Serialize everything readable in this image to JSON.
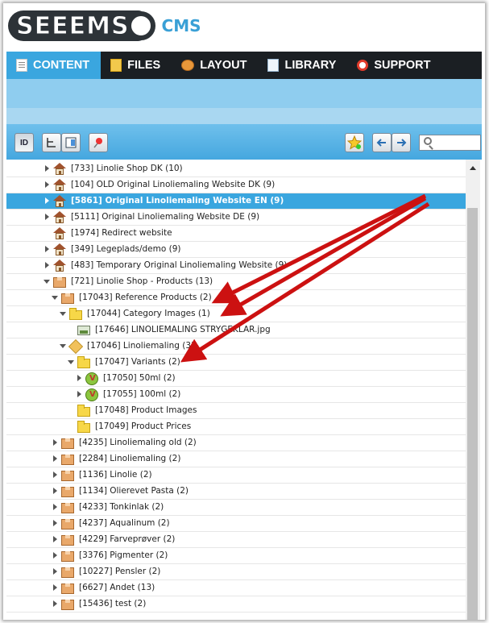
{
  "logo": {
    "text": "SEEEMS",
    "suffix": "CMS"
  },
  "nav": {
    "items": [
      {
        "label": "CONTENT",
        "icon": "document-icon",
        "active": true
      },
      {
        "label": "FILES",
        "icon": "files-icon",
        "active": false
      },
      {
        "label": "LAYOUT",
        "icon": "palette-icon",
        "active": false
      },
      {
        "label": "LIBRARY",
        "icon": "book-icon",
        "active": false
      },
      {
        "label": "SUPPORT",
        "icon": "lifebuoy-icon",
        "active": false
      }
    ]
  },
  "toolbar": {
    "id_label": "ID",
    "search_placeholder": ""
  },
  "tree": {
    "rows": [
      {
        "label": "[733] Linolie Shop DK (10)"
      },
      {
        "label": "[104] OLD Original Linoliemaling Website DK (9)"
      },
      {
        "label": "[5861] Original Linoliemaling Website EN (9)"
      },
      {
        "label": "[5111] Original Linoliemaling Website DE (9)"
      },
      {
        "label": "[1974] Redirect website"
      },
      {
        "label": "[349] Legeplads/demo (9)"
      },
      {
        "label": "[483] Temporary Original Linoliemaling Website (9)"
      },
      {
        "label": "[721] Linolie Shop - Products (13)"
      },
      {
        "label": "[17043] Reference Products (2)"
      },
      {
        "label": "[17044] Category Images (1)"
      },
      {
        "label": "[17646] LINOLIEMALING STRYGEKLAR.jpg"
      },
      {
        "label": "[17046] Linoliemaling (3)"
      },
      {
        "label": "[17047] Variants (2)"
      },
      {
        "label": "[17050] 50ml (2)"
      },
      {
        "label": "[17055] 100ml (2)"
      },
      {
        "label": "[17048] Product Images"
      },
      {
        "label": "[17049] Product Prices"
      },
      {
        "label": "[4235] Linoliemaling old (2)"
      },
      {
        "label": "[2284] Linoliemaling (2)"
      },
      {
        "label": "[1136] Linolie (2)"
      },
      {
        "label": "[1134] Olierevet Pasta (2)"
      },
      {
        "label": "[4233] Tonkinlak (2)"
      },
      {
        "label": "[4237] Aqualinum (2)"
      },
      {
        "label": "[4229] Farveprøver (2)"
      },
      {
        "label": "[3376] Pigmenter (2)"
      },
      {
        "label": "[10227] Pensler (2)"
      },
      {
        "label": "[6627] Andet (13)"
      },
      {
        "label": "[15436] test (2)"
      }
    ]
  },
  "colors": {
    "accent": "#3aa6df",
    "nav_bg": "#1b1f23",
    "annotation": "#cc1111"
  }
}
